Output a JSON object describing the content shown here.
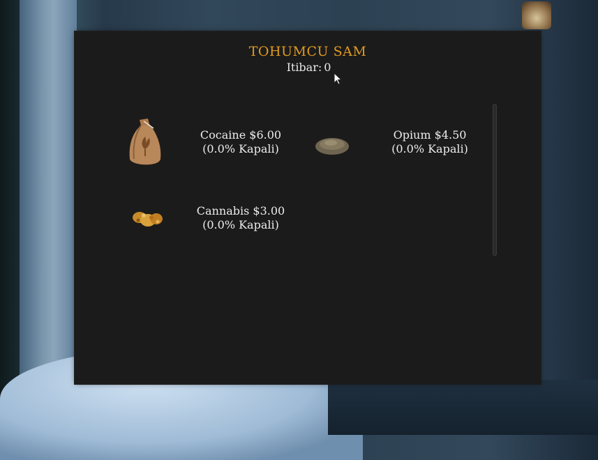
{
  "shop": {
    "title": "TOHUMCU SAM",
    "reputation_label": "Itibar:",
    "reputation_value": "0"
  },
  "items": [
    {
      "name_price": "Cocaine $6.00",
      "bonus": "(0.0% Kapali)",
      "icon": "seed-bag-icon"
    },
    {
      "name_price": "Opium $4.50",
      "bonus": "(0.0% Kapali)",
      "icon": "seed-pile-icon"
    },
    {
      "name_price": "Cannabis $3.00",
      "bonus": "(0.0% Kapali)",
      "icon": "cannabis-bud-icon"
    }
  ],
  "colors": {
    "title": "#e09a21",
    "panel": "#1b1b1b",
    "text": "#ececec"
  }
}
